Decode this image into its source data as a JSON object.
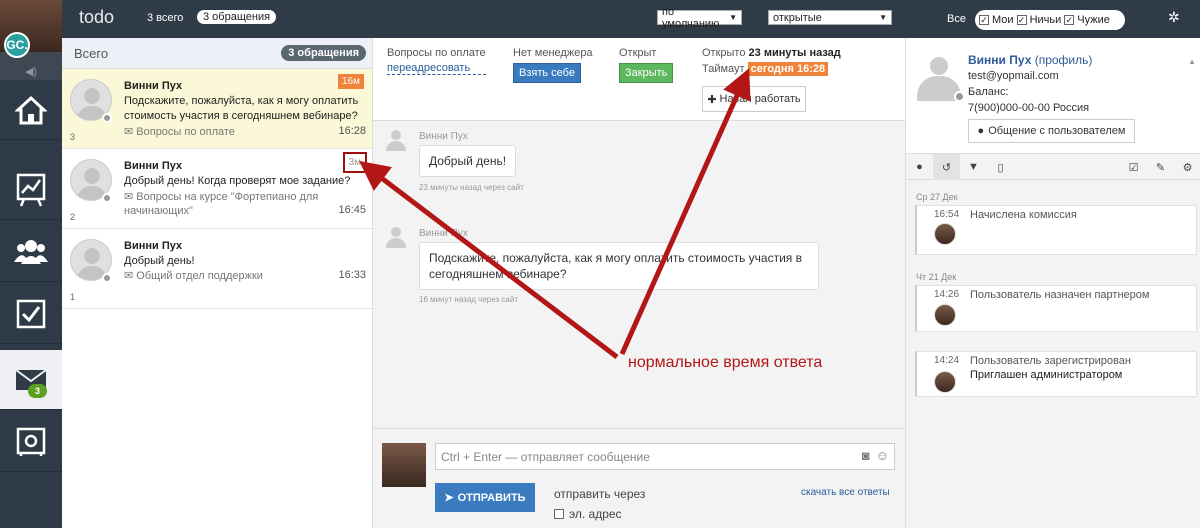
{
  "topbar": {
    "brand": "todo",
    "total_label": "3 всего",
    "requests_pill": "3 обращения",
    "sort_select": "по умолчанию",
    "status_select": "открытые",
    "filter_all": "Все",
    "filter_mine": "Мои",
    "filter_nobody": "Ничьи",
    "filter_others": "Чужие"
  },
  "sidebar": {
    "user_initials": "GC.",
    "mail_badge": "3",
    "items": [
      "home-icon",
      "chart-icon",
      "users-icon",
      "checkbox-icon",
      "mail-icon",
      "safe-icon"
    ]
  },
  "conversations": {
    "header": "Всего",
    "count_pill": "3 обращения",
    "items": [
      {
        "num": "3",
        "name": "Винни Пух",
        "message": "Подскажите, пожалуйста, как я могу оплатить стоимость участия в сегодняшнем вебинаре?",
        "topic": "Вопросы по оплате",
        "time": "16:28",
        "tag": "16м"
      },
      {
        "num": "2",
        "name": "Винни Пух",
        "message": "Добрый день! Когда проверят мое задание?",
        "topic": "Вопросы на курсе \"Фортепиано для начинающих\"",
        "time": "16:45",
        "tag": "3м"
      },
      {
        "num": "1",
        "name": "Винни Пух",
        "message": "Добрый день!",
        "topic": "Общий отдел поддержки",
        "time": "16:33",
        "tag": ""
      }
    ]
  },
  "ticket": {
    "topic_label": "Вопросы по оплате",
    "topic_link": "переадресовать",
    "manager_label": "Нет менеджера",
    "take_button": "Взять себе",
    "open_label": "Открыт",
    "close_button": "Закрыть",
    "opened_label": "Открыто",
    "opened_value": "23 минуты назад",
    "timeout_label": "Таймаут",
    "timeout_value": "сегодня 16:28",
    "start_button": "Начал работать"
  },
  "messages": [
    {
      "author": "Винни Пух",
      "text": "Добрый день!",
      "meta": "23 минуты назад через сайт"
    },
    {
      "author": "Винни Пух",
      "text": "Подскажите, пожалуйста, как я могу оплатить стоимость участия в сегодняшнем вебинаре?",
      "meta": "16 минут назад через сайт"
    }
  ],
  "composer": {
    "placeholder": "Ctrl + Enter — отправляет сообщение",
    "send_button": "ОТПРАВИТЬ",
    "send_via": "отправить через",
    "email_option": "эл. адрес",
    "download_all": "скачать все ответы"
  },
  "client": {
    "name": "Винни Пух",
    "profile_link": "(профиль)",
    "email": "test@yopmail.com",
    "balance_label": "Баланс:",
    "phone": "7(900)000-00-00 Россия",
    "chat_button": "Общение с пользователем"
  },
  "feed": [
    {
      "date": "Ср 27 Дек",
      "time": "16:54",
      "text": "Начислена комиссия",
      "detail": ""
    },
    {
      "date": "Чт 21 Дек",
      "time": "14:26",
      "text": "Пользователь назначен партнером",
      "detail": ""
    },
    {
      "date": "",
      "time": "14:24",
      "text": "Пользователь зарегистрирован",
      "detail": "Приглашен администратором"
    }
  ],
  "annotation": "нормальное время ответа",
  "colors": {
    "accent_red": "#b31616",
    "orange": "#f0833a",
    "blue": "#3a7bbf",
    "green": "#5cb85c",
    "dark": "#2f3b46"
  }
}
